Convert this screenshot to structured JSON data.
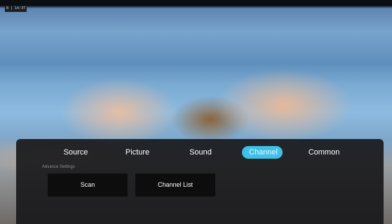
{
  "status": {
    "badge_text": "8 | 14:37"
  },
  "menu": {
    "tabs": [
      {
        "label": "Source"
      },
      {
        "label": "Picture"
      },
      {
        "label": "Sound"
      },
      {
        "label": "Channel",
        "active": true
      },
      {
        "label": "Common"
      }
    ],
    "accent_color": "#3fc0e8"
  },
  "channel_panel": {
    "section_label": "Advance Settings",
    "options": [
      {
        "label": "Scan"
      },
      {
        "label": "Channel List"
      }
    ]
  }
}
